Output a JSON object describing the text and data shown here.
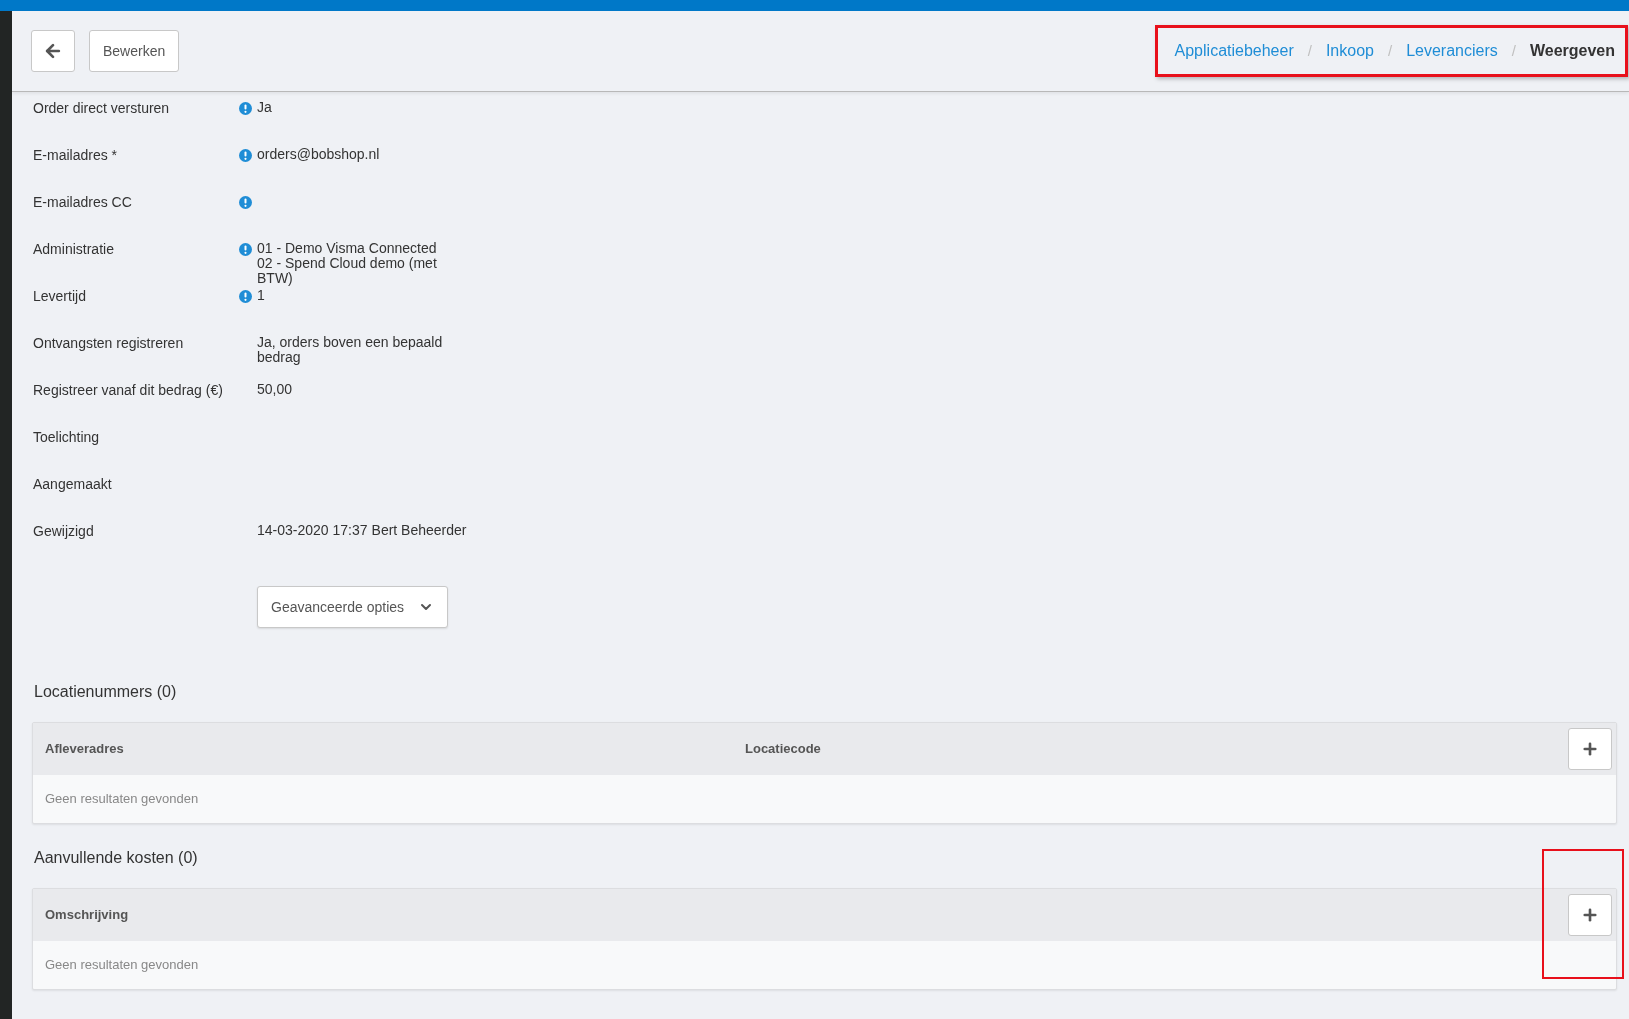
{
  "toolbar": {
    "buttons": [
      {
        "kind": "back"
      },
      {
        "kind": "text",
        "label": "Bewerken"
      }
    ]
  },
  "breadcrumb": {
    "highlighted": true,
    "items": [
      {
        "label": "Applicatiebeheer",
        "current": false
      },
      {
        "label": "Inkoop",
        "current": false
      },
      {
        "label": "Leveranciers",
        "current": false
      },
      {
        "label": "Weergeven",
        "current": true
      }
    ],
    "separator": "/"
  },
  "fields": [
    {
      "label": "Order direct versturen",
      "info": true,
      "value": [
        "Ja"
      ]
    },
    {
      "label": "E-mailadres *",
      "info": true,
      "value": [
        "orders@bobshop.nl"
      ]
    },
    {
      "label": "E-mailadres CC",
      "info": true
    },
    {
      "label": "Administratie",
      "info": true,
      "value": [
        "01 - Demo Visma Connected",
        "02 - Spend Cloud demo (met BTW)"
      ]
    },
    {
      "label": "Levertijd",
      "info": true,
      "value": [
        "1"
      ]
    },
    {
      "label": "Ontvangsten registreren",
      "info": false,
      "value": [
        "Ja, orders boven een bepaald bedrag"
      ]
    },
    {
      "label": "Registreer vanaf dit bedrag (€)",
      "info": false,
      "value": [
        "50,00"
      ]
    },
    {
      "label": "Toelichting",
      "info": false
    },
    {
      "label": "Aangemaakt",
      "info": false
    },
    {
      "label": "Gewijzigd",
      "info": false,
      "value": [
        "14-03-2020 17:37",
        "Bert Beheerder"
      ]
    }
  ],
  "advanced_button": {
    "label": "Geavanceerde opties",
    "expanded": false
  },
  "sections": [
    {
      "title": "Locatienummers (0)",
      "columns": [
        "Afleveradres",
        "Locatiecode"
      ],
      "empty_text": "Geen resultaten gevonden",
      "add_highlighted": false
    },
    {
      "title": "Aanvullende kosten (0)",
      "columns": [
        "Omschrijving"
      ],
      "empty_text": "Geen resultaten gevonden",
      "add_highlighted": true
    }
  ]
}
